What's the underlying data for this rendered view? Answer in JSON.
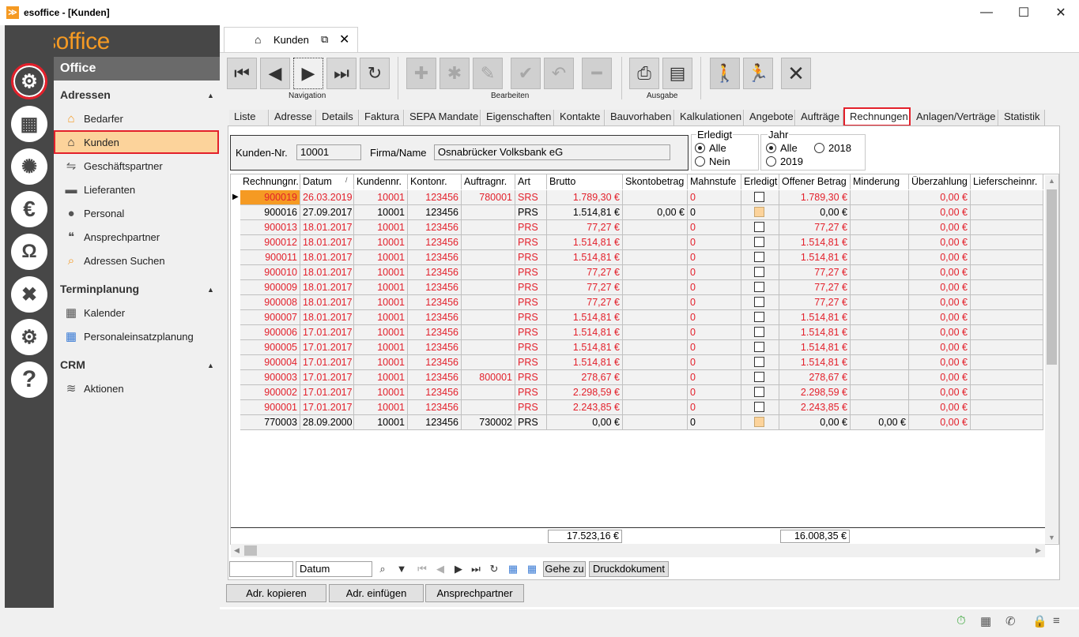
{
  "window": {
    "title": "esoffice - [Kunden]",
    "app_icon": "esoffice-icon"
  },
  "logo": {
    "text": "esoffice"
  },
  "sidebar_icons": [
    "settings-gear-icon",
    "calculator-icon",
    "alarm-light-icon",
    "euro-icon",
    "headset-icon",
    "tools-icon",
    "gears-icon",
    "help-icon"
  ],
  "nav": {
    "header": "Office",
    "sections": [
      {
        "title": "Adressen",
        "items": [
          {
            "label": "Bedarfer",
            "icon": "house-icon"
          },
          {
            "label": "Kunden",
            "icon": "house-icon",
            "selected": true
          },
          {
            "label": "Geschäftspartner",
            "icon": "handshake-icon"
          },
          {
            "label": "Lieferanten",
            "icon": "truck-icon"
          },
          {
            "label": "Personal",
            "icon": "people-icon"
          },
          {
            "label": "Ansprechpartner",
            "icon": "speech-icon"
          },
          {
            "label": "Adressen Suchen",
            "icon": "search-address-icon"
          }
        ]
      },
      {
        "title": "Terminplanung",
        "items": [
          {
            "label": "Kalender",
            "icon": "calendar-icon"
          },
          {
            "label": "Personaleinsatzplanung",
            "icon": "planning-icon"
          }
        ]
      },
      {
        "title": "CRM",
        "items": [
          {
            "label": "Aktionen",
            "icon": "tornado-icon"
          }
        ]
      }
    ]
  },
  "doc_tab": {
    "label": "Kunden"
  },
  "toolbar": {
    "groups": [
      "Navigation",
      "Bearbeiten",
      "Ausgabe"
    ]
  },
  "tabs": [
    "Liste",
    "Adresse",
    "Details",
    "Faktura",
    "SEPA Mandate",
    "Eigenschaften",
    "Kontakte",
    "Bauvorhaben",
    "Kalkulationen",
    "Angebote",
    "Aufträge",
    "Rechnungen",
    "Anlagen/Verträge",
    "Statistik"
  ],
  "customer": {
    "nr_label": "Kunden-Nr.",
    "nr_value": "10001",
    "name_label": "Firma/Name",
    "name_value": "Osnabrücker Volksbank eG"
  },
  "filter_erledigt": {
    "title": "Erledigt",
    "options": [
      "Alle",
      "Nein"
    ],
    "selected": "Alle"
  },
  "filter_jahr": {
    "title": "Jahr",
    "options": [
      "Alle",
      "2018",
      "2019"
    ],
    "selected": "Alle"
  },
  "grid": {
    "columns": [
      "Rechnungnr.",
      "Datum",
      "Kundennr.",
      "Kontonr.",
      "Auftragnr.",
      "Art",
      "Brutto",
      "Skontobetrag",
      "Mahnstufe",
      "Erledigt",
      "Offener Betrag",
      "Minderung",
      "Überzahlung",
      "Lieferscheinnr."
    ],
    "sort_indicator": "/",
    "rows": [
      {
        "nr": "900019",
        "datum": "26.03.2019",
        "kunde": "10001",
        "konto": "123456",
        "auftrag": "780001",
        "art": "SRS",
        "brutto": "1.789,30 €",
        "skonto": "",
        "mahn": "0",
        "erledigt": false,
        "offen": "1.789,30 €",
        "minderung": "",
        "ueber": "0,00 €",
        "red": true,
        "current": true
      },
      {
        "nr": "900016",
        "datum": "27.09.2017",
        "kunde": "10001",
        "konto": "123456",
        "auftrag": "",
        "art": "PRS",
        "brutto": "1.514,81 €",
        "skonto": "0,00 €",
        "mahn": "0",
        "erledigt": true,
        "offen": "0,00 €",
        "minderung": "",
        "ueber": "0,00 €",
        "red": false
      },
      {
        "nr": "900013",
        "datum": "18.01.2017",
        "kunde": "10001",
        "konto": "123456",
        "auftrag": "",
        "art": "PRS",
        "brutto": "77,27 €",
        "skonto": "",
        "mahn": "0",
        "erledigt": false,
        "offen": "77,27 €",
        "minderung": "",
        "ueber": "0,00 €",
        "red": true
      },
      {
        "nr": "900012",
        "datum": "18.01.2017",
        "kunde": "10001",
        "konto": "123456",
        "auftrag": "",
        "art": "PRS",
        "brutto": "1.514,81 €",
        "skonto": "",
        "mahn": "0",
        "erledigt": false,
        "offen": "1.514,81 €",
        "minderung": "",
        "ueber": "0,00 €",
        "red": true
      },
      {
        "nr": "900011",
        "datum": "18.01.2017",
        "kunde": "10001",
        "konto": "123456",
        "auftrag": "",
        "art": "PRS",
        "brutto": "1.514,81 €",
        "skonto": "",
        "mahn": "0",
        "erledigt": false,
        "offen": "1.514,81 €",
        "minderung": "",
        "ueber": "0,00 €",
        "red": true
      },
      {
        "nr": "900010",
        "datum": "18.01.2017",
        "kunde": "10001",
        "konto": "123456",
        "auftrag": "",
        "art": "PRS",
        "brutto": "77,27 €",
        "skonto": "",
        "mahn": "0",
        "erledigt": false,
        "offen": "77,27 €",
        "minderung": "",
        "ueber": "0,00 €",
        "red": true
      },
      {
        "nr": "900009",
        "datum": "18.01.2017",
        "kunde": "10001",
        "konto": "123456",
        "auftrag": "",
        "art": "PRS",
        "brutto": "77,27 €",
        "skonto": "",
        "mahn": "0",
        "erledigt": false,
        "offen": "77,27 €",
        "minderung": "",
        "ueber": "0,00 €",
        "red": true
      },
      {
        "nr": "900008",
        "datum": "18.01.2017",
        "kunde": "10001",
        "konto": "123456",
        "auftrag": "",
        "art": "PRS",
        "brutto": "77,27 €",
        "skonto": "",
        "mahn": "0",
        "erledigt": false,
        "offen": "77,27 €",
        "minderung": "",
        "ueber": "0,00 €",
        "red": true
      },
      {
        "nr": "900007",
        "datum": "18.01.2017",
        "kunde": "10001",
        "konto": "123456",
        "auftrag": "",
        "art": "PRS",
        "brutto": "1.514,81 €",
        "skonto": "",
        "mahn": "0",
        "erledigt": false,
        "offen": "1.514,81 €",
        "minderung": "",
        "ueber": "0,00 €",
        "red": true
      },
      {
        "nr": "900006",
        "datum": "17.01.2017",
        "kunde": "10001",
        "konto": "123456",
        "auftrag": "",
        "art": "PRS",
        "brutto": "1.514,81 €",
        "skonto": "",
        "mahn": "0",
        "erledigt": false,
        "offen": "1.514,81 €",
        "minderung": "",
        "ueber": "0,00 €",
        "red": true
      },
      {
        "nr": "900005",
        "datum": "17.01.2017",
        "kunde": "10001",
        "konto": "123456",
        "auftrag": "",
        "art": "PRS",
        "brutto": "1.514,81 €",
        "skonto": "",
        "mahn": "0",
        "erledigt": false,
        "offen": "1.514,81 €",
        "minderung": "",
        "ueber": "0,00 €",
        "red": true
      },
      {
        "nr": "900004",
        "datum": "17.01.2017",
        "kunde": "10001",
        "konto": "123456",
        "auftrag": "",
        "art": "PRS",
        "brutto": "1.514,81 €",
        "skonto": "",
        "mahn": "0",
        "erledigt": false,
        "offen": "1.514,81 €",
        "minderung": "",
        "ueber": "0,00 €",
        "red": true
      },
      {
        "nr": "900003",
        "datum": "17.01.2017",
        "kunde": "10001",
        "konto": "123456",
        "auftrag": "800001",
        "art": "PRS",
        "brutto": "278,67 €",
        "skonto": "",
        "mahn": "0",
        "erledigt": false,
        "offen": "278,67 €",
        "minderung": "",
        "ueber": "0,00 €",
        "red": true
      },
      {
        "nr": "900002",
        "datum": "17.01.2017",
        "kunde": "10001",
        "konto": "123456",
        "auftrag": "",
        "art": "PRS",
        "brutto": "2.298,59 €",
        "skonto": "",
        "mahn": "0",
        "erledigt": false,
        "offen": "2.298,59 €",
        "minderung": "",
        "ueber": "0,00 €",
        "red": true
      },
      {
        "nr": "900001",
        "datum": "17.01.2017",
        "kunde": "10001",
        "konto": "123456",
        "auftrag": "",
        "art": "PRS",
        "brutto": "2.243,85 €",
        "skonto": "",
        "mahn": "0",
        "erledigt": false,
        "offen": "2.243,85 €",
        "minderung": "",
        "ueber": "0,00 €",
        "red": true
      },
      {
        "nr": "770003",
        "datum": "28.09.2000",
        "kunde": "10001",
        "konto": "123456",
        "auftrag": "730002",
        "art": "PRS",
        "brutto": "0,00 €",
        "skonto": "",
        "mahn": "0",
        "erledigt": true,
        "offen": "0,00 €",
        "minderung": "0,00 €",
        "ueber": "0,00 €",
        "red": false
      }
    ],
    "totals": {
      "brutto": "17.523,16 €",
      "offen": "16.008,35 €"
    }
  },
  "search": {
    "value": "",
    "field": "Datum",
    "goto": "Gehe zu",
    "print": "Druckdokument"
  },
  "bottom_buttons": [
    "Adr. kopieren",
    "Adr. einfügen",
    "Ansprechpartner"
  ],
  "colors": {
    "accent": "#f59a23",
    "highlight": "#e3202b",
    "selected_bg": "#fcd39b",
    "dark": "#474747"
  }
}
